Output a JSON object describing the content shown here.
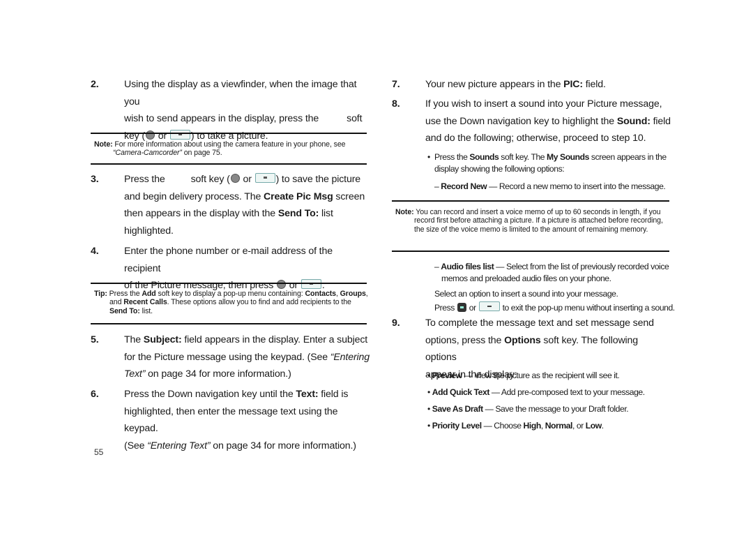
{
  "page_number": "55",
  "left_column": {
    "step2": {
      "num": "2.",
      "line1": "Using the display as a viewfinder, when the image that you",
      "line2": "wish to send appears in the display, press the",
      "line2_end": "soft",
      "line3_pre": "key (",
      "line3_or": " or ",
      "line3_post": ") to take a picture."
    },
    "note1": {
      "label": "Note:",
      "text_pre": " For more information about using the camera feature in your phone, see ",
      "ref": "“Camera-Camcorder”",
      "text_post": " on page 75."
    },
    "step3": {
      "num": "3.",
      "line1_pre": "Press the",
      "line1_mid": "soft key (",
      "line1_or": " or ",
      "line1_post": ") to save the picture",
      "line2_pre": "and begin delivery process. The ",
      "line2_bold": "Create Pic Msg",
      "line2_post": " screen",
      "line3_pre": "then appears in the display with the ",
      "line3_bold": "Send To:",
      "line3_post": " list",
      "line4": "highlighted."
    },
    "step4": {
      "num": "4.",
      "line1": "Enter the phone number or e-mail address of the recipient",
      "line2_pre": "of the Picture message, then press ",
      "line2_or": " or ",
      "line2_post": "."
    },
    "tip": {
      "label": "Tip:",
      "t1": " Press the ",
      "b1": "Add",
      "t2": " soft key to display a pop-up menu containing: ",
      "b2": "Contacts",
      "t3": ", ",
      "b3": "Groups",
      "t4": ", and ",
      "b4": "Recent Calls",
      "t5": ". These options allow you to find and add recipients to the ",
      "b5": "Send To:",
      "t6": " list."
    },
    "step5": {
      "num": "5.",
      "line1_pre": "The ",
      "line1_bold": "Subject:",
      "line1_post": " field appears in the display. Enter a subject",
      "line2_pre": "for the Picture message using the keypad. (See ",
      "line2_ital": "“Entering",
      "line3_ital": "Text”",
      "line3_post": " on page 34 for more information.)"
    },
    "step6": {
      "num": "6.",
      "line1_pre": "Press the Down navigation key until the ",
      "line1_bold": "Text:",
      "line1_post": " field is",
      "line2": "highlighted, then enter the message text using the keypad.",
      "line3_pre": "(See ",
      "line3_ital": "“Entering Text”",
      "line3_post": " on page 34 for more information.)"
    }
  },
  "right_column": {
    "step7": {
      "num": "7.",
      "text_pre": "Your new picture appears in the ",
      "bold": "PIC:",
      "text_post": " field."
    },
    "step8": {
      "num": "8.",
      "line1": "If you wish to insert a sound into your Picture message,",
      "line2_pre": "use the Down navigation key to highlight the ",
      "line2_bold": "Sound:",
      "line2_post": " field",
      "line3": "and do the following; otherwise, proceed to step 10.",
      "bullet": {
        "t1": "Press the ",
        "b1": "Sounds",
        "t2": " soft key. The ",
        "b2": "My Sounds",
        "t3": " screen appears in the display showing the following options:"
      },
      "option_record": {
        "label": "Record New",
        "desc": " — Record a new memo to insert into the message."
      }
    },
    "note2": {
      "label": "Note:",
      "text": " You can record and insert a voice memo of up to 60 seconds in length, if you record first before attaching a picture. If a picture is attached before recording, the size of the voice memo is limited to the amount of remaining memory."
    },
    "option_audio": {
      "label": "Audio files list",
      "desc": " — Select from the list of previously recorded voice memos and preloaded audio files on your phone."
    },
    "select_text": "Select an option to insert a sound into your message.",
    "press_pre": "Press ",
    "press_or": " or ",
    "press_post": " to exit the pop-up menu without inserting a sound.",
    "step9": {
      "num": "9.",
      "line1": "To complete the message text and set message send",
      "line2_pre": "options, press the ",
      "line2_bold": "Options",
      "line2_post": " soft key. The following options",
      "line3": "appear in the display:"
    },
    "options": [
      {
        "label": "Preview",
        "desc": " — View the picture as the recipient will see it."
      },
      {
        "label": "Add Quick Text",
        "desc": " — Add pre-composed text to your message."
      },
      {
        "label": "Save As Draft",
        "desc": " — Save the message to your Draft folder."
      },
      {
        "label": "Priority Level",
        "desc": " — Choose ",
        "b1": "High",
        "t1": ", ",
        "b2": "Normal",
        "t2": ", or ",
        "b3": "Low",
        "t3": "."
      }
    ]
  },
  "icons": {
    "round_key": "round-soft-key-icon",
    "ok_key": "ok-key-icon",
    "clear_key": "clear-key-icon",
    "back_key": "back-key-icon"
  }
}
